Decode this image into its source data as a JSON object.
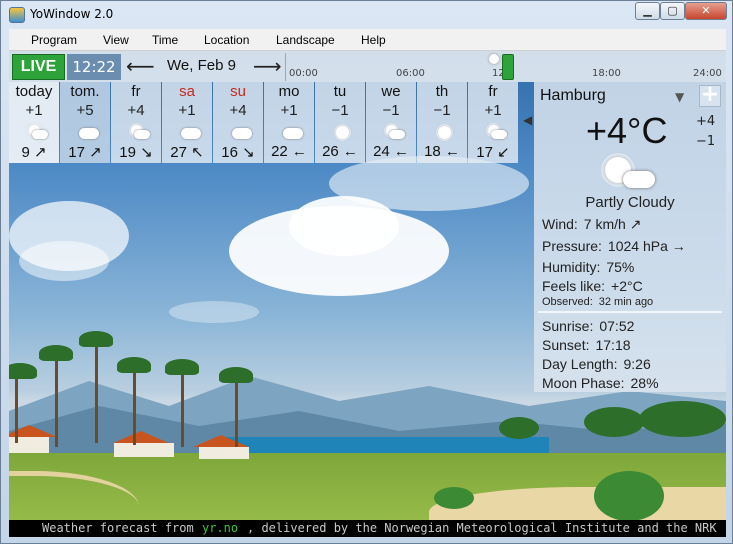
{
  "window": {
    "title": "YoWindow 2.0"
  },
  "menu": {
    "items": [
      "Program",
      "View",
      "Time",
      "Location",
      "Landscape",
      "Help"
    ]
  },
  "topbar": {
    "live_label": "LIVE",
    "clock": "12:22",
    "date": "We, Feb 9",
    "timeline_ticks": [
      "00:00",
      "06:00",
      "12",
      "18:00",
      "24:00"
    ],
    "slider_fraction": 0.5
  },
  "forecast": {
    "days": [
      {
        "name": "today",
        "temp": "+1",
        "icon": "sun-cloud-icon",
        "wind": "9 ↗"
      },
      {
        "name": "tom.",
        "temp": "+5",
        "icon": "cloud-icon",
        "wind": "17 ↗"
      },
      {
        "name": "fr",
        "temp": "+4",
        "icon": "sun-cloud-icon",
        "wind": "19 ↘"
      },
      {
        "name": "sa",
        "temp": "+1",
        "icon": "cloud-icon",
        "wind": "27 ↖",
        "weekend": true
      },
      {
        "name": "su",
        "temp": "+4",
        "icon": "cloud-icon",
        "wind": "16 ↘",
        "weekend": true
      },
      {
        "name": "mo",
        "temp": "+1",
        "icon": "cloud-icon",
        "wind": "22 ←"
      },
      {
        "name": "tu",
        "temp": "−1",
        "icon": "sun-icon",
        "wind": "26 ←"
      },
      {
        "name": "we",
        "temp": "−1",
        "icon": "sun-cloud-icon",
        "wind": "24 ←"
      },
      {
        "name": "th",
        "temp": "−1",
        "icon": "sun-icon",
        "wind": "18 ←"
      },
      {
        "name": "fr",
        "temp": "+1",
        "icon": "sun-cloud-icon",
        "wind": "17 ↙"
      }
    ]
  },
  "panel": {
    "city": "Hamburg",
    "add_label": "+",
    "temp_now": "+4°C",
    "temp_hi": "+4",
    "temp_lo": "−1",
    "condition": "Partly Cloudy",
    "wind_label": "Wind:",
    "wind_value": "7 km/h  ↗",
    "pressure_label": "Pressure:",
    "pressure_value": "1024 hPa  →",
    "humidity_label": "Humidity:",
    "humidity_value": "75%",
    "feels_label": "Feels like:",
    "feels_value": "+2°C",
    "observed_label": "Observed:",
    "observed_value": "32 min ago",
    "sunrise_label": "Sunrise:",
    "sunrise_value": "07:52",
    "sunset_label": "Sunset:",
    "sunset_value": "17:18",
    "daylength_label": "Day Length:",
    "daylength_value": "9:26",
    "moon_label": "Moon Phase:",
    "moon_value": "28%"
  },
  "status": {
    "text1": "Weather forecast from",
    "link": "yr.no",
    "text2": ", delivered by the Norwegian Meteorological Institute and the NRK"
  },
  "logo_text": "Yo"
}
